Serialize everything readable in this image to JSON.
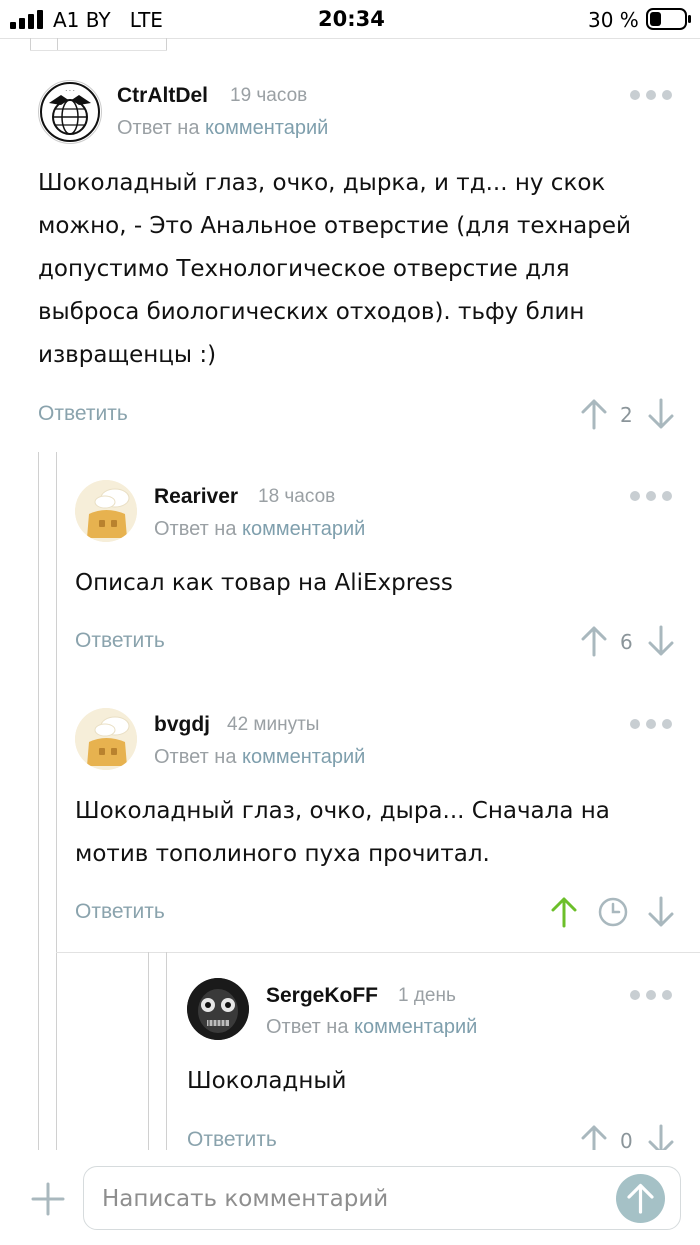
{
  "status": {
    "carrier": "A1 BY",
    "network": "LTE",
    "time": "20:34",
    "battery": "30 %"
  },
  "comments": [
    {
      "author": "CtrAltDel",
      "time": "19 часов",
      "reply_prefix": "Ответ на",
      "reply_link": "комментарий",
      "text": [
        "Шоколадный глаз, очко, дырка, и тд... ну скок",
        "можно, - Это Анальное отверстие (для технарей",
        "допустимо Технологическое отверстие для",
        "выброса биологических отходов). тьфу блин",
        "извращенцы :)"
      ],
      "reply_label": "Ответить",
      "rating": "2"
    },
    {
      "author": "Reariver",
      "time": "18 часов",
      "reply_prefix": "Ответ на",
      "reply_link": "комментарий",
      "text": [
        "Описал как товар на AliExpress"
      ],
      "reply_label": "Ответить",
      "rating": "6"
    },
    {
      "author": "bvgdj",
      "time": "42 минуты",
      "reply_prefix": "Ответ на",
      "reply_link": "комментарий",
      "text": [
        "Шоколадный глаз, очко, дыра... Сначала на",
        "мотив тополиного пуха прочитал."
      ],
      "reply_label": "Ответить",
      "rating": ""
    },
    {
      "author": "SergeKoFF",
      "time": "1 день",
      "reply_prefix": "Ответ на",
      "reply_link": "комментарий",
      "text": [
        "Шоколадный"
      ],
      "reply_label": "Ответить",
      "rating": "0"
    }
  ],
  "composer": {
    "placeholder": "Написать комментарий"
  },
  "colors": {
    "accent": "#7f9fad",
    "upvote_active": "#6cbf2a",
    "muted": "#9aa0a4",
    "send": "#a5c1c6"
  }
}
